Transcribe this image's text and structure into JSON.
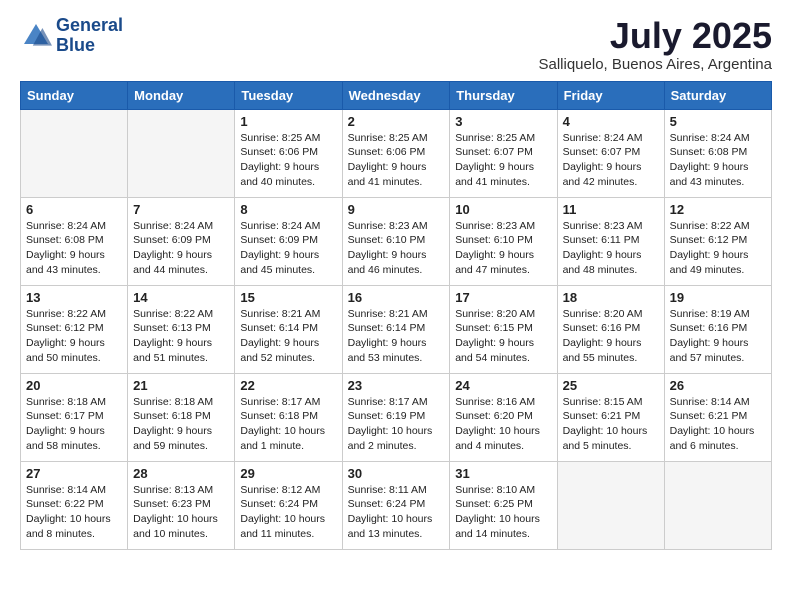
{
  "logo": {
    "line1": "General",
    "line2": "Blue"
  },
  "title": "July 2025",
  "subtitle": "Salliquelo, Buenos Aires, Argentina",
  "days_header": [
    "Sunday",
    "Monday",
    "Tuesday",
    "Wednesday",
    "Thursday",
    "Friday",
    "Saturday"
  ],
  "weeks": [
    [
      {
        "day": "",
        "info": ""
      },
      {
        "day": "",
        "info": ""
      },
      {
        "day": "1",
        "info": "Sunrise: 8:25 AM\nSunset: 6:06 PM\nDaylight: 9 hours\nand 40 minutes."
      },
      {
        "day": "2",
        "info": "Sunrise: 8:25 AM\nSunset: 6:06 PM\nDaylight: 9 hours\nand 41 minutes."
      },
      {
        "day": "3",
        "info": "Sunrise: 8:25 AM\nSunset: 6:07 PM\nDaylight: 9 hours\nand 41 minutes."
      },
      {
        "day": "4",
        "info": "Sunrise: 8:24 AM\nSunset: 6:07 PM\nDaylight: 9 hours\nand 42 minutes."
      },
      {
        "day": "5",
        "info": "Sunrise: 8:24 AM\nSunset: 6:08 PM\nDaylight: 9 hours\nand 43 minutes."
      }
    ],
    [
      {
        "day": "6",
        "info": "Sunrise: 8:24 AM\nSunset: 6:08 PM\nDaylight: 9 hours\nand 43 minutes."
      },
      {
        "day": "7",
        "info": "Sunrise: 8:24 AM\nSunset: 6:09 PM\nDaylight: 9 hours\nand 44 minutes."
      },
      {
        "day": "8",
        "info": "Sunrise: 8:24 AM\nSunset: 6:09 PM\nDaylight: 9 hours\nand 45 minutes."
      },
      {
        "day": "9",
        "info": "Sunrise: 8:23 AM\nSunset: 6:10 PM\nDaylight: 9 hours\nand 46 minutes."
      },
      {
        "day": "10",
        "info": "Sunrise: 8:23 AM\nSunset: 6:10 PM\nDaylight: 9 hours\nand 47 minutes."
      },
      {
        "day": "11",
        "info": "Sunrise: 8:23 AM\nSunset: 6:11 PM\nDaylight: 9 hours\nand 48 minutes."
      },
      {
        "day": "12",
        "info": "Sunrise: 8:22 AM\nSunset: 6:12 PM\nDaylight: 9 hours\nand 49 minutes."
      }
    ],
    [
      {
        "day": "13",
        "info": "Sunrise: 8:22 AM\nSunset: 6:12 PM\nDaylight: 9 hours\nand 50 minutes."
      },
      {
        "day": "14",
        "info": "Sunrise: 8:22 AM\nSunset: 6:13 PM\nDaylight: 9 hours\nand 51 minutes."
      },
      {
        "day": "15",
        "info": "Sunrise: 8:21 AM\nSunset: 6:14 PM\nDaylight: 9 hours\nand 52 minutes."
      },
      {
        "day": "16",
        "info": "Sunrise: 8:21 AM\nSunset: 6:14 PM\nDaylight: 9 hours\nand 53 minutes."
      },
      {
        "day": "17",
        "info": "Sunrise: 8:20 AM\nSunset: 6:15 PM\nDaylight: 9 hours\nand 54 minutes."
      },
      {
        "day": "18",
        "info": "Sunrise: 8:20 AM\nSunset: 6:16 PM\nDaylight: 9 hours\nand 55 minutes."
      },
      {
        "day": "19",
        "info": "Sunrise: 8:19 AM\nSunset: 6:16 PM\nDaylight: 9 hours\nand 57 minutes."
      }
    ],
    [
      {
        "day": "20",
        "info": "Sunrise: 8:18 AM\nSunset: 6:17 PM\nDaylight: 9 hours\nand 58 minutes."
      },
      {
        "day": "21",
        "info": "Sunrise: 8:18 AM\nSunset: 6:18 PM\nDaylight: 9 hours\nand 59 minutes."
      },
      {
        "day": "22",
        "info": "Sunrise: 8:17 AM\nSunset: 6:18 PM\nDaylight: 10 hours\nand 1 minute."
      },
      {
        "day": "23",
        "info": "Sunrise: 8:17 AM\nSunset: 6:19 PM\nDaylight: 10 hours\nand 2 minutes."
      },
      {
        "day": "24",
        "info": "Sunrise: 8:16 AM\nSunset: 6:20 PM\nDaylight: 10 hours\nand 4 minutes."
      },
      {
        "day": "25",
        "info": "Sunrise: 8:15 AM\nSunset: 6:21 PM\nDaylight: 10 hours\nand 5 minutes."
      },
      {
        "day": "26",
        "info": "Sunrise: 8:14 AM\nSunset: 6:21 PM\nDaylight: 10 hours\nand 6 minutes."
      }
    ],
    [
      {
        "day": "27",
        "info": "Sunrise: 8:14 AM\nSunset: 6:22 PM\nDaylight: 10 hours\nand 8 minutes."
      },
      {
        "day": "28",
        "info": "Sunrise: 8:13 AM\nSunset: 6:23 PM\nDaylight: 10 hours\nand 10 minutes."
      },
      {
        "day": "29",
        "info": "Sunrise: 8:12 AM\nSunset: 6:24 PM\nDaylight: 10 hours\nand 11 minutes."
      },
      {
        "day": "30",
        "info": "Sunrise: 8:11 AM\nSunset: 6:24 PM\nDaylight: 10 hours\nand 13 minutes."
      },
      {
        "day": "31",
        "info": "Sunrise: 8:10 AM\nSunset: 6:25 PM\nDaylight: 10 hours\nand 14 minutes."
      },
      {
        "day": "",
        "info": ""
      },
      {
        "day": "",
        "info": ""
      }
    ]
  ]
}
